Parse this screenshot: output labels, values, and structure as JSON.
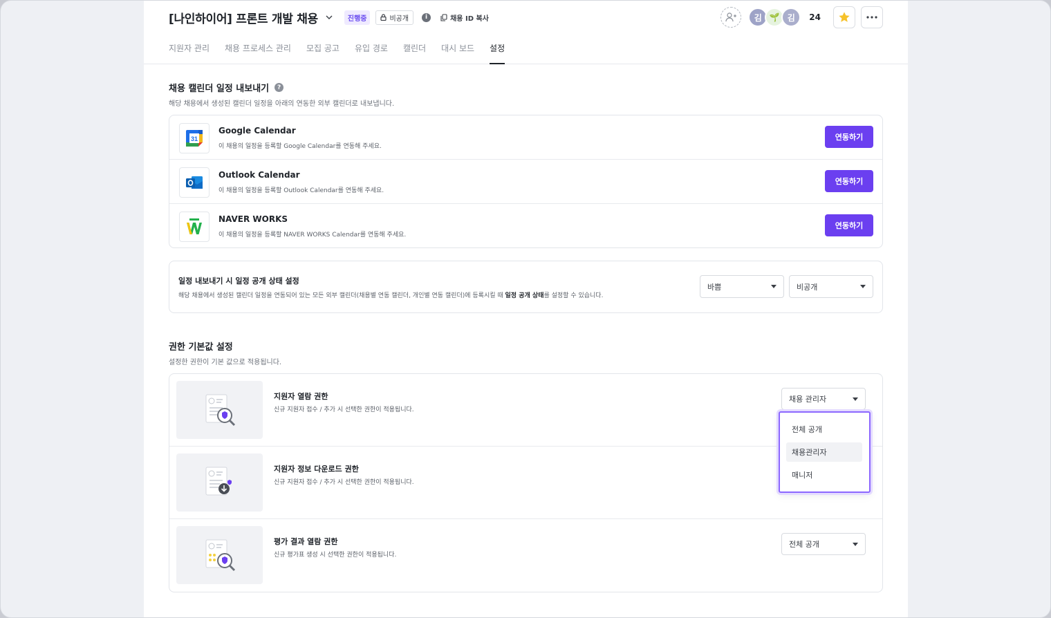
{
  "header": {
    "title": "[나인하이어] 프론트 개발 채용",
    "status_badge": "진행중",
    "visibility_badge": "비공개",
    "copy_label": "채용 ID 복사",
    "members": [
      {
        "label": "김",
        "color": "#9ea3c7"
      },
      {
        "label": "🌱",
        "color": "#e6f3df"
      },
      {
        "label": "김",
        "color": "#aaaecc"
      }
    ],
    "member_count": "24"
  },
  "tabs": [
    "지원자 관리",
    "채용 프로세스 관리",
    "모집 공고",
    "유입 경로",
    "캘린더",
    "대시 보드",
    "설정"
  ],
  "active_tab": "설정",
  "calendar_section": {
    "title": "채용 캘린더 일정 내보내기",
    "desc": "해당 채용에서 생성된 캘린더 일정을 아래의 연동한 외부 캘린더로 내보냅니다.",
    "items": [
      {
        "name": "Google Calendar",
        "desc": "이 채용의 일정을 등록할 Google Calendar를 연동해 주세요.",
        "button": "연동하기",
        "icon": "google-calendar-icon"
      },
      {
        "name": "Outlook Calendar",
        "desc": "이 채용의 일정을 등록할 Outlook Calendar를 연동해 주세요.",
        "button": "연동하기",
        "icon": "outlook-icon"
      },
      {
        "name": "NAVER WORKS",
        "desc": "이 채용의 일정을 등록할 NAVER WORKS Calendar를 연동해 주세요.",
        "button": "연동하기",
        "icon": "naver-works-icon"
      }
    ]
  },
  "export_setting": {
    "title": "일정 내보내기 시 일정 공개 상태 설정",
    "desc_pre": "해당 채용에서 생성된 캘린더 일정을 연동되어 있는 모든 외부 캘린더(채용별 연동 캘린더, 개인별 연동 캘린더)에 등록시킬 때 ",
    "desc_bold": "일정 공개 상태",
    "desc_post": "를 설정할 수 있습니다.",
    "select_busy": "바쁨",
    "select_visibility": "비공개"
  },
  "permission_section": {
    "title": "권한 기본값 설정",
    "desc": "설정한 권한이 기본 값으로 적용됩니다.",
    "items": [
      {
        "name": "지원자 열람 권한",
        "desc": "신규 지원자 접수 / 추가 시 선택한 권한이 적용됩니다.",
        "value": "채용 관리자"
      },
      {
        "name": "지원자 정보 다운로드 권한",
        "desc": "신규 지원자 접수 / 추가 시 선택한 권한이 적용됩니다.",
        "value": ""
      },
      {
        "name": "평가 결과 열람 권한",
        "desc": "신규 평가표 생성 시 선택한 권한이 적용됩니다.",
        "value": "전체 공개"
      }
    ],
    "dropdown_options": [
      "전체 공개",
      "채용관리자",
      "매니저"
    ],
    "dropdown_hover": "채용관리자"
  },
  "colors": {
    "accent": "#6b3ff0",
    "dropdown_border": "#8c67ff"
  }
}
